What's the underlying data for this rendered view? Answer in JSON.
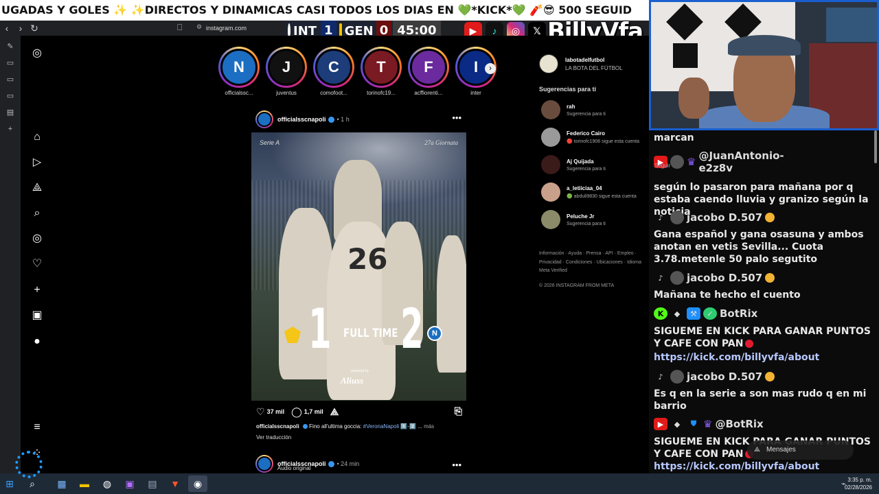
{
  "ticker": {
    "text": "UGADAS Y GOLES ✨ ✨DIRECTOS Y DINAMICAS CASI TODOS LOS DIAS EN 💚*KICK*💚 🧨😎 500 SEGUID"
  },
  "browser": {
    "url": "instagram.com",
    "back": "‹",
    "forward": "›",
    "reload": "↻"
  },
  "scoreboard": {
    "home": "INT",
    "home_score": "1",
    "away": "GEN",
    "away_score": "0",
    "clock": "45:00",
    "home_color": "#0a3fa8",
    "away_color": "#b81c1c"
  },
  "socials": {
    "youtube": "▶",
    "tiktok": "♪",
    "instagram": "◎",
    "x": "𝕏",
    "brand": "BillyVfa"
  },
  "left_rail": {
    "icons": [
      "✎",
      "▭",
      "▭",
      "▭",
      "▤",
      "+"
    ]
  },
  "stories": [
    {
      "name": "officialssc...",
      "glyph": "N",
      "bg": "#1b6ec2"
    },
    {
      "name": "juventus",
      "glyph": "J",
      "bg": "#111111"
    },
    {
      "name": "comofoot...",
      "glyph": "C",
      "bg": "#1c3c7a"
    },
    {
      "name": "torinofc19...",
      "glyph": "T",
      "bg": "#7a1a22"
    },
    {
      "name": "acffiorenti...",
      "glyph": "F",
      "bg": "#6b2a9e"
    },
    {
      "name": "inter",
      "glyph": "I",
      "bg": "#0a2a85"
    }
  ],
  "post": {
    "user": "officialsscnapoli",
    "time": "• 1 h",
    "more": "•••",
    "image": {
      "league": "Serie A",
      "round": "27a Giornata",
      "jersey": "26",
      "home_score": "1",
      "away_score": "2",
      "full_time": "FULL TIME",
      "powered": "powered by",
      "sponsor": "Aliuss"
    },
    "likes": "37 mil",
    "comments": "1,7 mil",
    "caption_user": "officialsscnapoli",
    "caption_text": "Fino all'ultima goccia:",
    "caption_tag": "#VeronaNapoli",
    "caption_tail": "1️⃣-2️⃣ ...",
    "caption_more": "más",
    "translate": "Ver traducción"
  },
  "post2": {
    "user": "officialsscnapoli",
    "time": "• 24 min",
    "subtitle": "Audio original"
  },
  "profile": {
    "user": "labotadelfutbol",
    "name": "LA BOTA DEL FÚTBOL"
  },
  "suggestions_title": "Sugerencias para ti",
  "suggestions": [
    {
      "user": "rah",
      "sub": "Sugerencia para ti",
      "color": "#6a4c3e"
    },
    {
      "user": "Federico Cairo",
      "sub": "🔴 torinofc1906 sigue esta cuenta",
      "color": "#9a9a9a"
    },
    {
      "user": "Aj Quijada",
      "sub": "Sugerencia para ti",
      "color": "#3b1a1a"
    },
    {
      "user": "a_letiiciaa_04",
      "sub": "🟢 abduli9830 sigue esta cuenta",
      "color": "#c9a08a"
    },
    {
      "user": "Peluche Jr",
      "sub": "Sugerencia para ti",
      "color": "#8b8b6a"
    }
  ],
  "footer": {
    "line1": "Información · Ayuda · Prensa · API · Empleo ·",
    "line2": "Privacidad · Condiciones · Ubicaciones · Idioma",
    "line3": "Meta Verified",
    "copyright": "© 2026 INSTAGRAM FROM META"
  },
  "chat": {
    "m0": "marcan",
    "u1": "@JuanAntonio-\ne2z8v",
    "seguir": "Seguir",
    "m1": "según lo pasaron para mañana por q estaba caendo lluvia y granizo según la noticia",
    "u2": "jacobo D.507",
    "m2": "Gana español y gana osasuna y ambos anotan en vetis Sevilla... Cuota 3.78.metenle 50 palo segutito",
    "u3": "jacobo D.507",
    "m3": "Mañana te hecho el cuento",
    "u4": "BotRix",
    "m4": "SIGUEME EN KICK PARA GANAR PUNTOS Y CAFE CON PAN",
    "l4": "https://kick.com/billyvfa/about",
    "u5": "jacobo D.507",
    "m5": "Es q en la serie a son mas rudo q en mi barrio",
    "u6": "@BotRix",
    "m6": "SIGUEME EN KICK PARA GANAR PUNTOS Y CAFE CON PAN",
    "l6": "https://kick.com/billyvfa/about",
    "mensajes": "Mensajes"
  },
  "taskbar": {
    "time": "3:35 p. m.",
    "date": "02/28/2026"
  }
}
